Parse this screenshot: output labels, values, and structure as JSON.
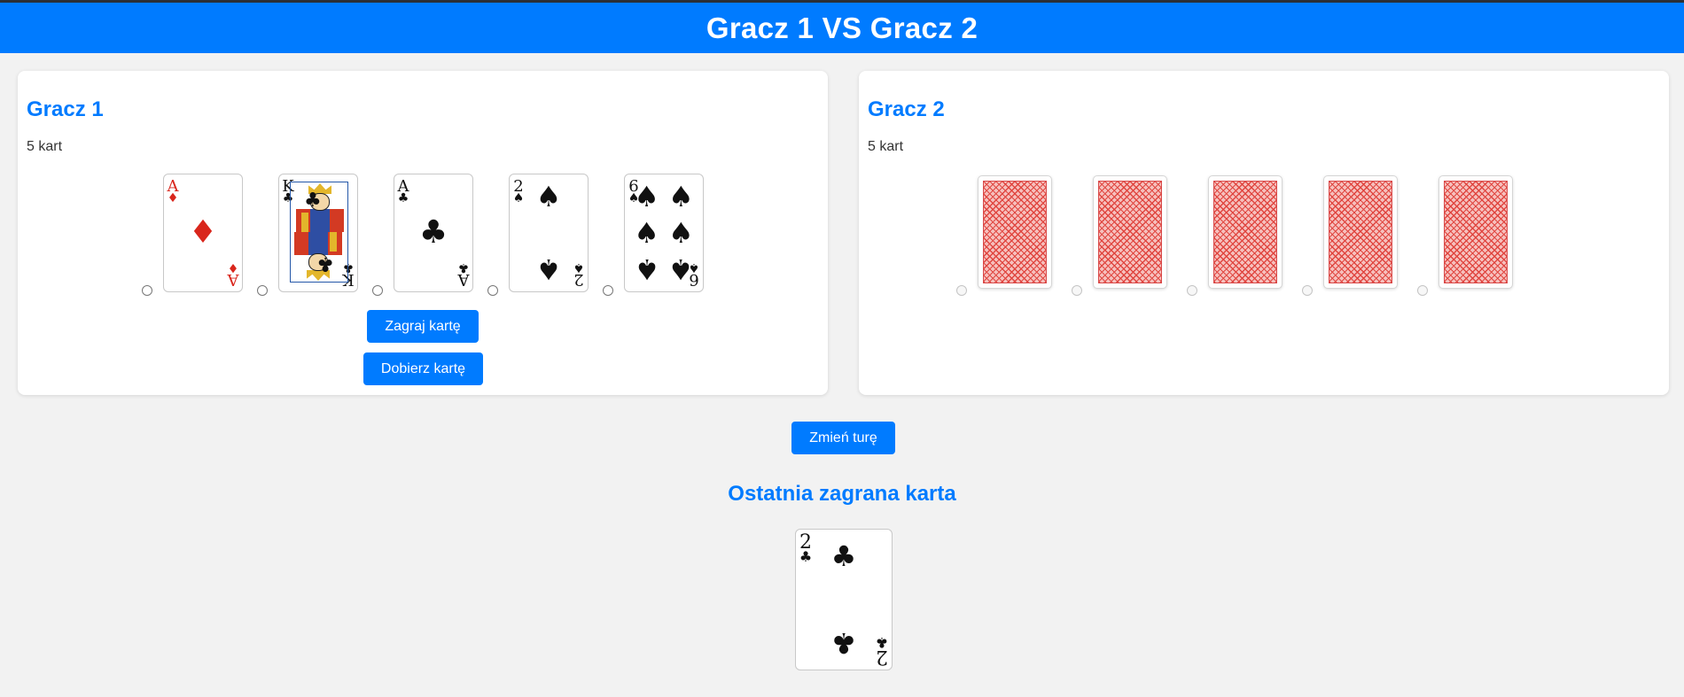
{
  "header": {
    "title": "Gracz 1 VS Gracz 2"
  },
  "players": [
    {
      "name": "Gracz 1",
      "count_text": "5 kart",
      "hand": [
        {
          "rank": "A",
          "suit": "♦",
          "color": "red",
          "face_up": true
        },
        {
          "rank": "K",
          "suit": "♣",
          "color": "black",
          "face_up": true
        },
        {
          "rank": "A",
          "suit": "♣",
          "color": "black",
          "face_up": true
        },
        {
          "rank": "2",
          "suit": "♠",
          "color": "black",
          "face_up": true
        },
        {
          "rank": "6",
          "suit": "♠",
          "color": "black",
          "face_up": true
        }
      ],
      "buttons": {
        "play": "Zagraj kartę",
        "draw": "Dobierz kartę"
      }
    },
    {
      "name": "Gracz 2",
      "count_text": "5 kart",
      "hand": [
        {
          "face_up": false
        },
        {
          "face_up": false
        },
        {
          "face_up": false
        },
        {
          "face_up": false
        },
        {
          "face_up": false
        }
      ]
    }
  ],
  "turn_button": "Zmień turę",
  "last_played": {
    "title": "Ostatnia zagrana karta",
    "card": {
      "rank": "2",
      "suit": "♣",
      "color": "black"
    }
  },
  "colors": {
    "accent": "#007bff",
    "red_suit": "#d9261c",
    "card_back": "#e0453f"
  }
}
